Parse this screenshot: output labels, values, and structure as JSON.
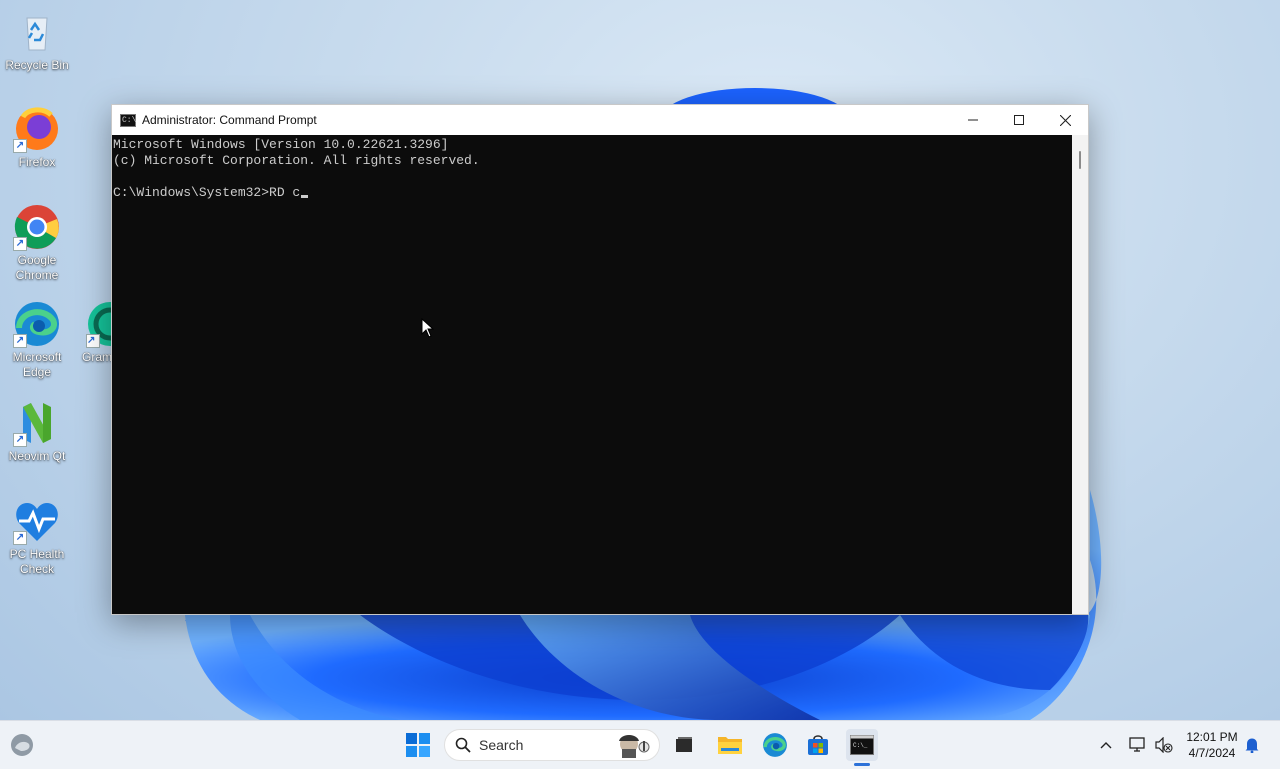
{
  "desktop": {
    "icons": [
      {
        "id": "recycle-bin",
        "label": "Recycle Bin"
      },
      {
        "id": "firefox",
        "label": "Firefox"
      },
      {
        "id": "chrome",
        "label": "Google Chrome"
      },
      {
        "id": "edge",
        "label": "Microsoft Edge"
      },
      {
        "id": "grammarly",
        "label": "Gram"
      },
      {
        "id": "neovim",
        "label": "Neovim Qt"
      },
      {
        "id": "pc-health",
        "label": "PC Health Check"
      }
    ]
  },
  "window": {
    "title": "Administrator: Command Prompt",
    "icon": "cmd-icon",
    "controls": [
      "minimize-icon",
      "maximize-icon",
      "close-icon"
    ],
    "console": {
      "lines": [
        "Microsoft Windows [Version 10.0.22621.3296]",
        "(c) Microsoft Corporation. All rights reserved.",
        "",
        "C:\\Windows\\System32>RD c"
      ]
    }
  },
  "taskbar": {
    "search_placeholder": "Search",
    "pinned": [
      "start-icon",
      "search-icon",
      "task-view-icon",
      "file-explorer-icon",
      "edge-icon",
      "store-icon",
      "terminal-icon"
    ],
    "active_app": "terminal-icon",
    "tray": [
      "chevron-up-icon",
      "network-icon",
      "speaker-muted-icon",
      "notification-bell-icon"
    ],
    "time": "12:01 PM",
    "date": "4/7/2024"
  },
  "colors": {
    "console_bg": "#0c0c0c",
    "console_fg": "#cccccc",
    "accent": "#2c71d8"
  }
}
